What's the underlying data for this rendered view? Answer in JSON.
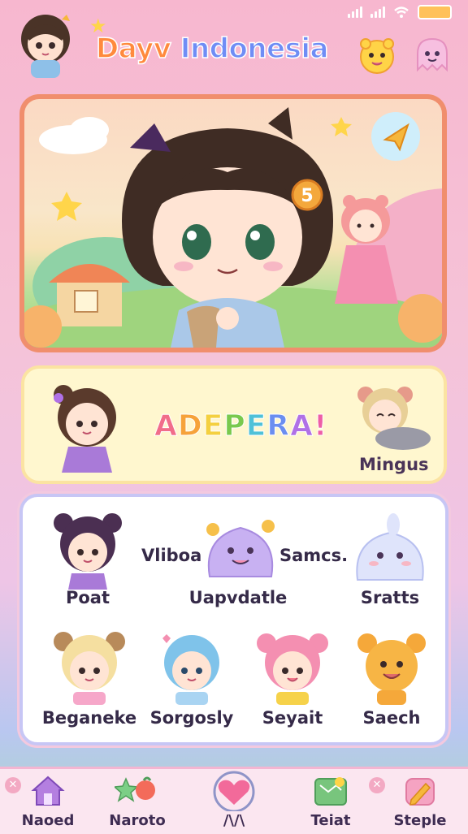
{
  "app": {
    "title_part1": "Dayv",
    "title_part2": "Indonesia"
  },
  "status_bar": {
    "battery_color": "#ffc15a"
  },
  "hero": {
    "icon": "paper-plane-icon",
    "badge_number": "5"
  },
  "banner": {
    "letters": [
      {
        "char": "A",
        "color": "#f16d8a"
      },
      {
        "char": "D",
        "color": "#f6a23a"
      },
      {
        "char": "E",
        "color": "#f4d03f"
      },
      {
        "char": "P",
        "color": "#79c94d"
      },
      {
        "char": "E",
        "color": "#4fc1d8"
      },
      {
        "char": "R",
        "color": "#6b8ef0"
      },
      {
        "char": "A",
        "color": "#b071e6"
      },
      {
        "char": "!",
        "color": "#ee5ea6"
      }
    ],
    "character_name": "Mingus"
  },
  "grid": {
    "row1": {
      "left_label": "Poat",
      "center_top_label": "Vliboa",
      "center_top_right_label": "Samcs.",
      "center_label": "Uapvdatle",
      "right_label": "Sratts"
    },
    "row2": [
      "Beganeke",
      "Sorgosly",
      "Seyait",
      "Saech"
    ]
  },
  "nav": {
    "items": [
      {
        "label": "Naoed",
        "icon": "home-icon"
      },
      {
        "label": "Naroto",
        "icon": "star-fruit-icon"
      },
      {
        "label": "/\\/\\",
        "icon": "heart-icon"
      },
      {
        "label": "Teiat",
        "icon": "map-icon"
      },
      {
        "label": "Steple",
        "icon": "pencil-icon"
      }
    ]
  }
}
